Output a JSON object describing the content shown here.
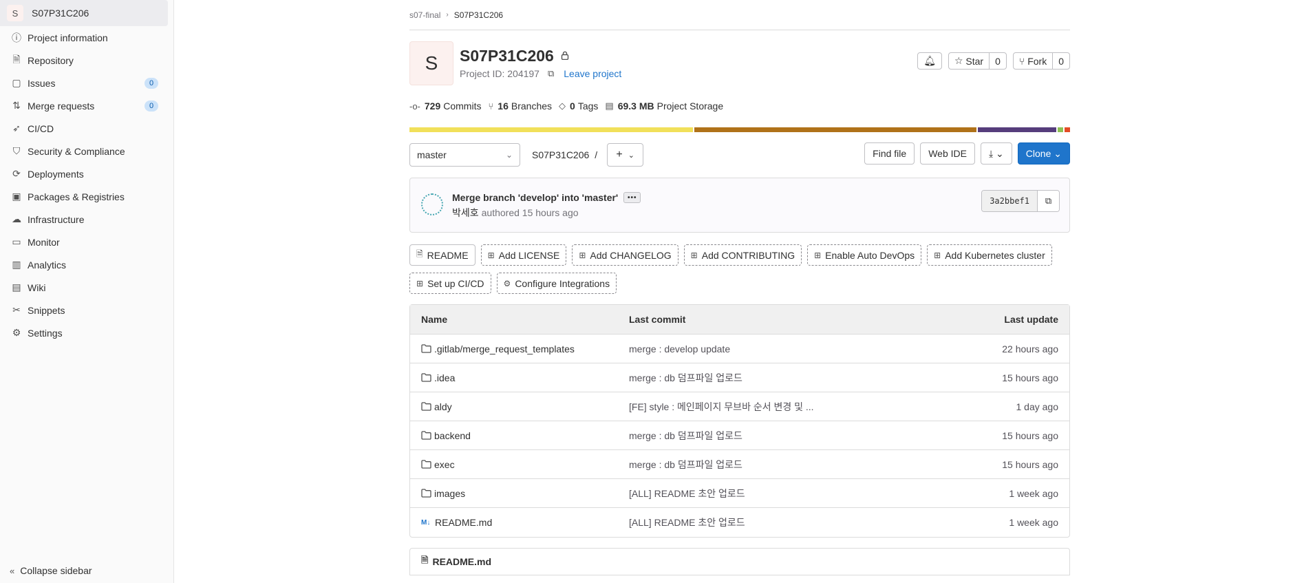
{
  "sidebar": {
    "project_avatar": "S",
    "project_name": "S07P31C206",
    "items": [
      {
        "label": "Project information",
        "icon": "info-icon"
      },
      {
        "label": "Repository",
        "icon": "doc-icon"
      },
      {
        "label": "Issues",
        "icon": "issues-icon",
        "count": "0"
      },
      {
        "label": "Merge requests",
        "icon": "merge-request-icon",
        "count": "0"
      },
      {
        "label": "CI/CD",
        "icon": "rocket-icon"
      },
      {
        "label": "Security & Compliance",
        "icon": "shield-icon"
      },
      {
        "label": "Deployments",
        "icon": "deployments-icon"
      },
      {
        "label": "Packages & Registries",
        "icon": "package-icon"
      },
      {
        "label": "Infrastructure",
        "icon": "cloud-icon"
      },
      {
        "label": "Monitor",
        "icon": "monitor-icon"
      },
      {
        "label": "Analytics",
        "icon": "chart-icon"
      },
      {
        "label": "Wiki",
        "icon": "book-icon"
      },
      {
        "label": "Snippets",
        "icon": "scissors-icon"
      },
      {
        "label": "Settings",
        "icon": "gear-icon"
      }
    ],
    "collapse_label": "Collapse sidebar"
  },
  "breadcrumb": {
    "parent": "s07-final",
    "current": "S07P31C206"
  },
  "project": {
    "avatar": "S",
    "title": "S07P31C206",
    "id_text": "Project ID: 204197",
    "leave_label": "Leave project",
    "star_label": "Star",
    "star_count": "0",
    "fork_label": "Fork",
    "fork_count": "0"
  },
  "stats": {
    "commits_num": "729",
    "commits_label": "Commits",
    "branches_num": "16",
    "branches_label": "Branches",
    "tags_num": "0",
    "tags_label": "Tags",
    "storage_num": "69.3 MB",
    "storage_label": "Project Storage"
  },
  "languages": [
    {
      "color": "#f1e05a",
      "share": 43.1
    },
    {
      "color": "#b07219",
      "share": 42.9
    },
    {
      "color": "#563d7c",
      "share": 11.9
    },
    {
      "color": "#8fc155",
      "share": 0.9
    },
    {
      "color": "#e34c26",
      "share": 0.8
    }
  ],
  "toolbar": {
    "branch": "master",
    "path_root": "S07P31C206",
    "path_sep": "/",
    "find_file": "Find file",
    "web_ide": "Web IDE",
    "clone": "Clone"
  },
  "commit": {
    "message": "Merge branch 'develop' into 'master'",
    "author": "박세호",
    "authored_text": "authored 15 hours ago",
    "sha": "3a2bbef1"
  },
  "quick_actions": [
    {
      "label": "README",
      "style": "solid"
    },
    {
      "label": "Add LICENSE",
      "style": "dashed"
    },
    {
      "label": "Add CHANGELOG",
      "style": "dashed"
    },
    {
      "label": "Add CONTRIBUTING",
      "style": "dashed"
    },
    {
      "label": "Enable Auto DevOps",
      "style": "dashed"
    },
    {
      "label": "Add Kubernetes cluster",
      "style": "dashed"
    },
    {
      "label": "Set up CI/CD",
      "style": "dashed"
    },
    {
      "label": "Configure Integrations",
      "style": "dashed"
    }
  ],
  "table": {
    "headers": {
      "name": "Name",
      "commit": "Last commit",
      "date": "Last update"
    },
    "rows": [
      {
        "name": ".gitlab/merge_request_templates",
        "type": "folder",
        "commit": "merge : develop update",
        "date": "22 hours ago"
      },
      {
        "name": ".idea",
        "type": "folder",
        "commit": "merge : db 덤프파일 업로드",
        "date": "15 hours ago"
      },
      {
        "name": "aldy",
        "type": "folder",
        "commit": "[FE] style : 메인페이지 무브바 순서 변경 및 ...",
        "date": "1 day ago"
      },
      {
        "name": "backend",
        "type": "folder",
        "commit": "merge : db 덤프파일 업로드",
        "date": "15 hours ago"
      },
      {
        "name": "exec",
        "type": "folder",
        "commit": "merge : db 덤프파일 업로드",
        "date": "15 hours ago"
      },
      {
        "name": "images",
        "type": "folder",
        "commit": "[ALL] README 초안 업로드",
        "date": "1 week ago"
      },
      {
        "name": "README.md",
        "type": "markdown",
        "commit": "[ALL] README 초안 업로드",
        "date": "1 week ago"
      }
    ]
  },
  "readme_title": "README.md"
}
